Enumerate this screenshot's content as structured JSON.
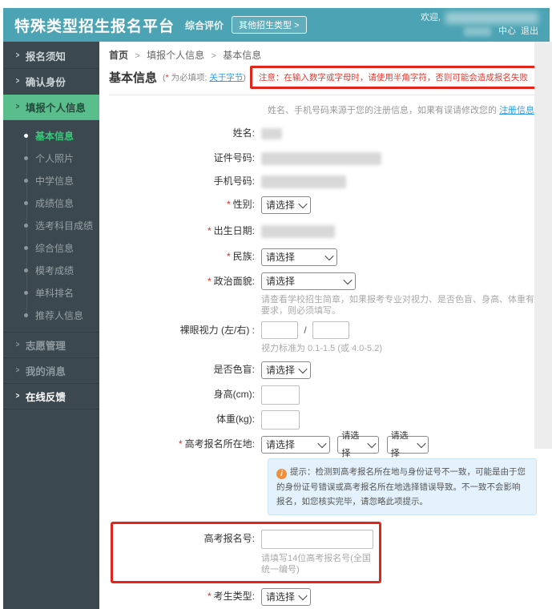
{
  "header": {
    "title": "特殊类型招生报名平台",
    "subtitle": "综合评价",
    "other_types_button": "其他招生类型 >",
    "welcome": "欢迎,",
    "user_center": "中心",
    "logout": "退出"
  },
  "sidebar": {
    "arrow": ">",
    "items_top": [
      "报名须知",
      "确认身份"
    ],
    "active_item": "填报个人信息",
    "sub_items": [
      "基本信息",
      "个人照片",
      "中学信息",
      "成绩信息",
      "选考科目成绩",
      "综合信息",
      "模考成绩",
      "单科排名",
      "推荐人信息"
    ],
    "items_bottom": [
      "志愿管理",
      "我的消息",
      "在线反馈"
    ]
  },
  "breadcrumb": {
    "home": "首页",
    "sep": ">",
    "level2": "填报个人信息",
    "level3": "基本信息"
  },
  "page": {
    "title": "基本信息",
    "paren_open": "(",
    "star": "*",
    "required_note": "为必填项;",
    "about_link": "关于字节",
    "paren_close": ")",
    "notice": "注意：在输入数字或字母时，请使用半角字符，否则可能会造成报名失败"
  },
  "form": {
    "register_note": "姓名、手机号码来源于您的注册信息，如果有误请修改您的",
    "register_link": "注册信息",
    "select_placeholder": "请选择",
    "required_star": "*",
    "labels": {
      "name": "姓名:",
      "cert_no": "证件号码:",
      "phone": "手机号码:",
      "gender": "性别:",
      "birth_date": "出生日期:",
      "ethnicity": "民族:",
      "political_status": "政治面貌:",
      "vision": "裸眼视力 (左/右) :",
      "color_blind": "是否色盲:",
      "height": "身高(cm):",
      "weight": "体重(kg):",
      "gaokao_location": "高考报名所在地:",
      "gaokao_no": "高考报名号:",
      "candidate_type": "考生类型:"
    },
    "hints": {
      "political": "请查看学校招生简章，如果报考专业对视力、是否色盲、身高、体重有要求，则必须填写。",
      "vision": "视力标准为 0.1-1.5 (或 4.0-5.2)",
      "gaokao_no": "请填写14位高考报名号(全国统一编号)"
    },
    "vision_separator": "/",
    "info_box": {
      "icon": "i",
      "text": "提示：检测到高考报名所在地与身份证号不一致，可能是由于您的身份证号错误或高考报名所在地选择错误导致。不一致不会影响报名，如您核实完毕，请忽略此项提示。"
    }
  },
  "colors": {
    "header_teal": "#4BA3B3",
    "sidebar_dark": "#3B4850",
    "active_green": "#5ABE8C",
    "active_sub_green": "#3EC77C",
    "link_blue": "#2E9FE6",
    "notice_red": "#E23B31",
    "annotation_red": "#E1251B",
    "info_box_bg": "#E3F2FC",
    "info_icon_orange": "#F08F3E"
  }
}
